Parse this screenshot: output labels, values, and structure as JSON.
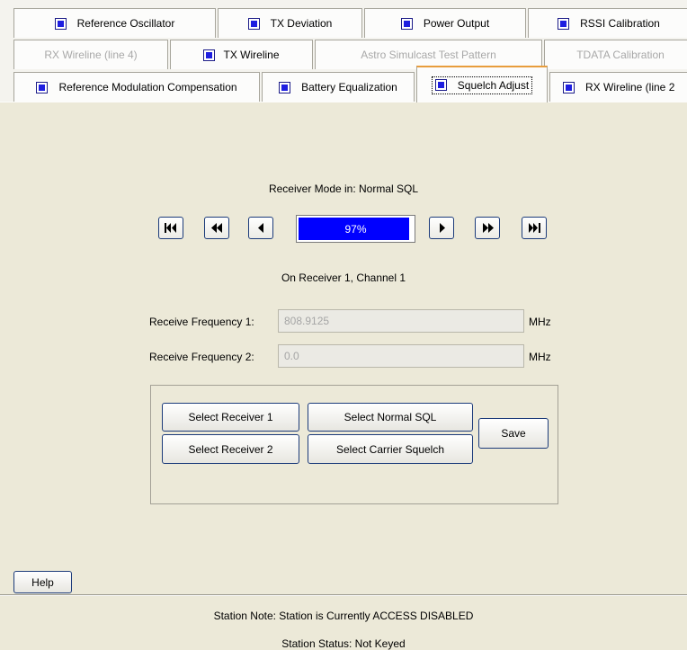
{
  "tabs": {
    "row1": [
      {
        "label": "Reference Oscillator",
        "enabled": true
      },
      {
        "label": "TX Deviation",
        "enabled": true
      },
      {
        "label": "Power Output",
        "enabled": true
      },
      {
        "label": "RSSI Calibration",
        "enabled": true
      }
    ],
    "row2": [
      {
        "label": "RX Wireline (line 4)",
        "enabled": false
      },
      {
        "label": "TX Wireline",
        "enabled": true
      },
      {
        "label": "Astro Simulcast Test Pattern",
        "enabled": false
      },
      {
        "label": "TDATA Calibration",
        "enabled": false
      }
    ],
    "row3": [
      {
        "label": "Reference Modulation Compensation",
        "enabled": true
      },
      {
        "label": "Battery Equalization",
        "enabled": true
      },
      {
        "label": "Squelch Adjust",
        "enabled": true,
        "selected": true
      },
      {
        "label": "RX Wireline (line 2",
        "enabled": true
      }
    ]
  },
  "receiver_mode": "Receiver Mode in: Normal SQL",
  "progress": {
    "value_percent": 97,
    "text": "97%",
    "fill_color": "#0000ff"
  },
  "nav_icons": [
    "skip-to-start-icon",
    "fast-rewind-icon",
    "step-back-icon",
    "step-forward-icon",
    "fast-forward-icon",
    "skip-to-end-icon"
  ],
  "receiver_channel": "On Receiver 1, Channel 1",
  "frequency1": {
    "label": "Receive Frequency 1:",
    "value": "808.9125",
    "unit": "MHz"
  },
  "frequency2": {
    "label": "Receive Frequency 2:",
    "value": "0.0",
    "unit": "MHz"
  },
  "buttons": {
    "select_receiver_1": "Select Receiver 1",
    "select_receiver_2": "Select Receiver 2",
    "select_normal_sql": "Select Normal SQL",
    "select_carrier_squelch": "Select Carrier Squelch",
    "save": "Save",
    "help": "Help"
  },
  "status": {
    "station_note": "Station Note:  Station is Currently ACCESS DISABLED",
    "station_status": "Station Status:  Not Keyed"
  },
  "colors": {
    "checkbox_fill": "#1e1ee0",
    "selected_tab_accent": "#e89d3c",
    "background": "#ece9d8"
  }
}
